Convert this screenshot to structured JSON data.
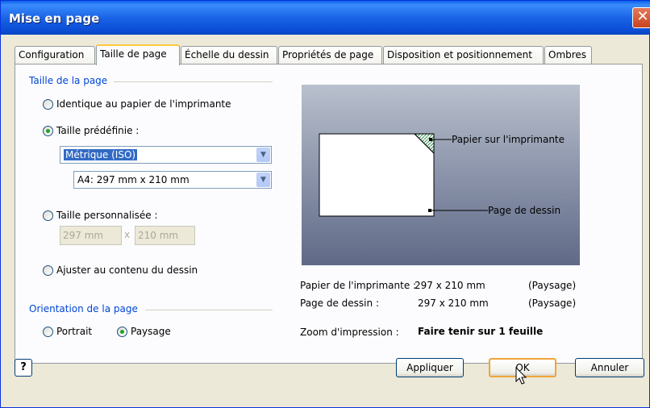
{
  "window": {
    "title": "Mise en page"
  },
  "tabs": [
    {
      "label": "Configuration"
    },
    {
      "label": "Taille de page"
    },
    {
      "label": "Échelle du dessin"
    },
    {
      "label": "Propriétés de page"
    },
    {
      "label": "Disposition et positionnement"
    },
    {
      "label": "Ombres"
    }
  ],
  "page_size": {
    "group_label": "Taille de la page",
    "option_same": "Identique au papier de l'imprimante",
    "option_predefined": "Taille prédéfinie :",
    "predefined_standard": "Métrique (ISO)",
    "predefined_size": "A4:  297 mm x 210 mm",
    "option_custom": "Taille personnalisée :",
    "custom_width": "297 mm",
    "custom_sep": "x",
    "custom_height": "210 mm",
    "option_fit": "Ajuster au contenu du dessin"
  },
  "orientation": {
    "group_label": "Orientation de la page",
    "portrait": "Portrait",
    "landscape": "Paysage"
  },
  "preview": {
    "printer_paper_label": "Papier sur l'imprimante",
    "drawing_page_label": "Page de dessin"
  },
  "info": {
    "printer_paper_label": "Papier de l'imprimante :",
    "printer_paper_size": "297 x 210 mm",
    "printer_paper_orient": "(Paysage)",
    "drawing_page_label": "Page de dessin :",
    "drawing_page_size": "297 x 210 mm",
    "drawing_page_orient": "(Paysage)",
    "zoom_label": "Zoom d'impression :",
    "zoom_value": "Faire tenir sur 1 feuille"
  },
  "buttons": {
    "apply": "Appliquer",
    "ok": "OK",
    "cancel": "Annuler",
    "help_glyph": "?"
  },
  "colors": {
    "titlebar": "#0a5fe8",
    "accent_group_label": "#0046d5",
    "selection": "#316ac5"
  }
}
